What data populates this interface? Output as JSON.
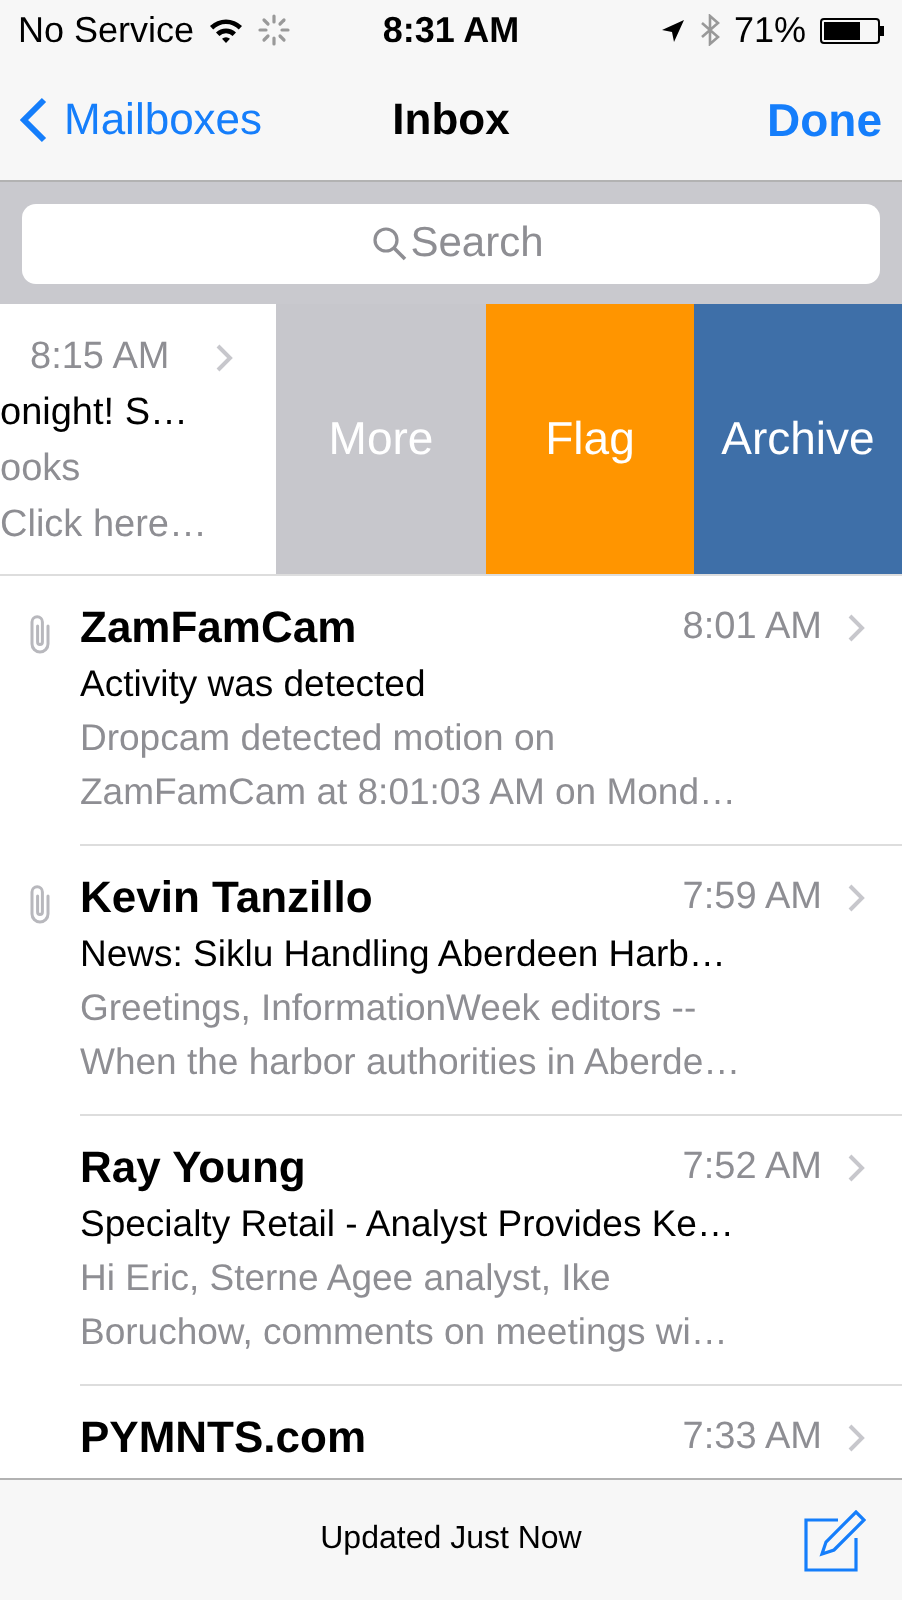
{
  "status_bar": {
    "carrier": "No Service",
    "time": "8:31 AM",
    "battery": "71%"
  },
  "nav": {
    "back": "Mailboxes",
    "title": "Inbox",
    "action": "Done"
  },
  "search": {
    "placeholder": "Search"
  },
  "swiped_message": {
    "time": "8:15 AM",
    "subject": "onight! S…",
    "preview": [
      "ooks",
      "Click here…"
    ],
    "actions": [
      {
        "label": "More",
        "color": "#c7c7cc"
      },
      {
        "label": "Flag",
        "color": "#ff9500"
      },
      {
        "label": "Archive",
        "color": "#3e6fa8"
      }
    ]
  },
  "messages": [
    {
      "sender": "ZamFamCam",
      "time": "8:01 AM",
      "attachment": true,
      "subject": "Activity was detected",
      "preview": [
        "Dropcam detected motion on",
        "ZamFamCam at 8:01:03 AM on Mond…"
      ]
    },
    {
      "sender": "Kevin Tanzillo",
      "time": "7:59 AM",
      "attachment": true,
      "subject": "News: Siklu Handling Aberdeen Harb…",
      "preview": [
        "Greetings, InformationWeek editors --",
        "When the harbor authorities in Aberde…"
      ]
    },
    {
      "sender": "Ray Young",
      "time": "7:52 AM",
      "attachment": false,
      "subject": "Specialty Retail - Analyst Provides Ke…",
      "preview": [
        "Hi Eric, Sterne Agee analyst, Ike",
        "Boruchow, comments on meetings wi…"
      ]
    },
    {
      "sender": "PYMNTS.com",
      "time": "7:33 AM",
      "attachment": false
    }
  ],
  "toolbar": {
    "status": "Updated Just Now"
  }
}
